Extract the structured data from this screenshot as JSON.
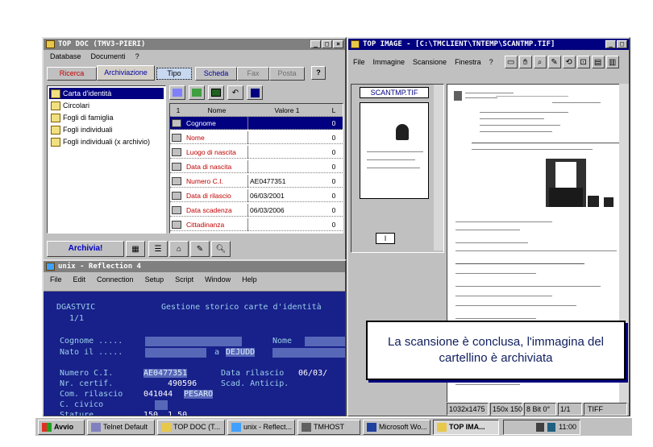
{
  "topdoc": {
    "title": "TOP DOC (TMV3-PIERI)",
    "menu": [
      "Database",
      "Documenti",
      "?"
    ],
    "tabs": [
      "Ricerca",
      "Archiviazione",
      "Tipo",
      "Scheda",
      "Fax",
      "Posta",
      "?"
    ],
    "tree": [
      "Carta d'identità",
      "Circolari",
      "Fogli di famiglia",
      "Fogli individuali",
      "Fogli individuali (x archivio)"
    ],
    "grid_headers": [
      "1",
      "Nome",
      "Valore 1",
      "L"
    ],
    "grid_rows": [
      {
        "name": "Cognome",
        "value": "",
        "l": "0"
      },
      {
        "name": "Nome",
        "value": "",
        "l": "0"
      },
      {
        "name": "Luogo di nascita",
        "value": "",
        "l": "0"
      },
      {
        "name": "Data di nascita",
        "value": "",
        "l": "0"
      },
      {
        "name": "Numero C.I.",
        "value": "AE0477351",
        "l": "0"
      },
      {
        "name": "Data di rilascio",
        "value": "06/03/2001",
        "l": "0"
      },
      {
        "name": "Data scadenza",
        "value": "06/03/2006",
        "l": "0"
      },
      {
        "name": "Cittadinanza",
        "value": "",
        "l": "0"
      }
    ],
    "archive_button": "Archivia!"
  },
  "reflection": {
    "title": "unix - Reflection 4",
    "menu": [
      "File",
      "Edit",
      "Connection",
      "Setup",
      "Script",
      "Window",
      "Help"
    ],
    "program": "DGASTVIC",
    "screen_title": "Gestione storico carte d'identità",
    "page": "1/1",
    "lbl_cognome": "Cognome .....",
    "lbl_nome": "Nome",
    "lbl_nato": "Nato il .....",
    "lbl_a": "a",
    "val_nato_place": "DEJUDD",
    "lbl_numero": "Numero C.I.",
    "val_numero": "AE0477351",
    "lbl_data_rilascio": "Data rilascio",
    "val_data_rilascio": "06/03/",
    "lbl_nr_certif": "Nr. certif.",
    "val_nr_certif": "490596",
    "lbl_scad": "Scad. Anticip.",
    "lbl_com": "Com. rilascio",
    "val_com": "041044",
    "val_com2": "PESARO",
    "lbl_civico": "C. civico",
    "lbl_stature": "Stature",
    "val_stature": "150  1.50"
  },
  "topimage": {
    "title": "TOP IMAGE - [C:\\TMCLIENT\\TNTEMP\\SCANTMP.TIF]",
    "menu": [
      "File",
      "Immagine",
      "Scansione",
      "Finestra",
      "?"
    ],
    "thumb_label": "SCANTMP.TIF",
    "status": [
      "1032x1475",
      "150x 150",
      "8 Bit 0°",
      "1/1",
      "TIFF"
    ]
  },
  "callout": "La scansione è conclusa, l'immagina del cartellino è archiviata",
  "taskbar": {
    "start": "Avvio",
    "items": [
      "Telnet Default",
      "TOP DOC (T...",
      "unix - Reflect...",
      "TMHOST",
      "Microsoft Wo...",
      "TOP IMA..."
    ],
    "clock": "11:00"
  }
}
